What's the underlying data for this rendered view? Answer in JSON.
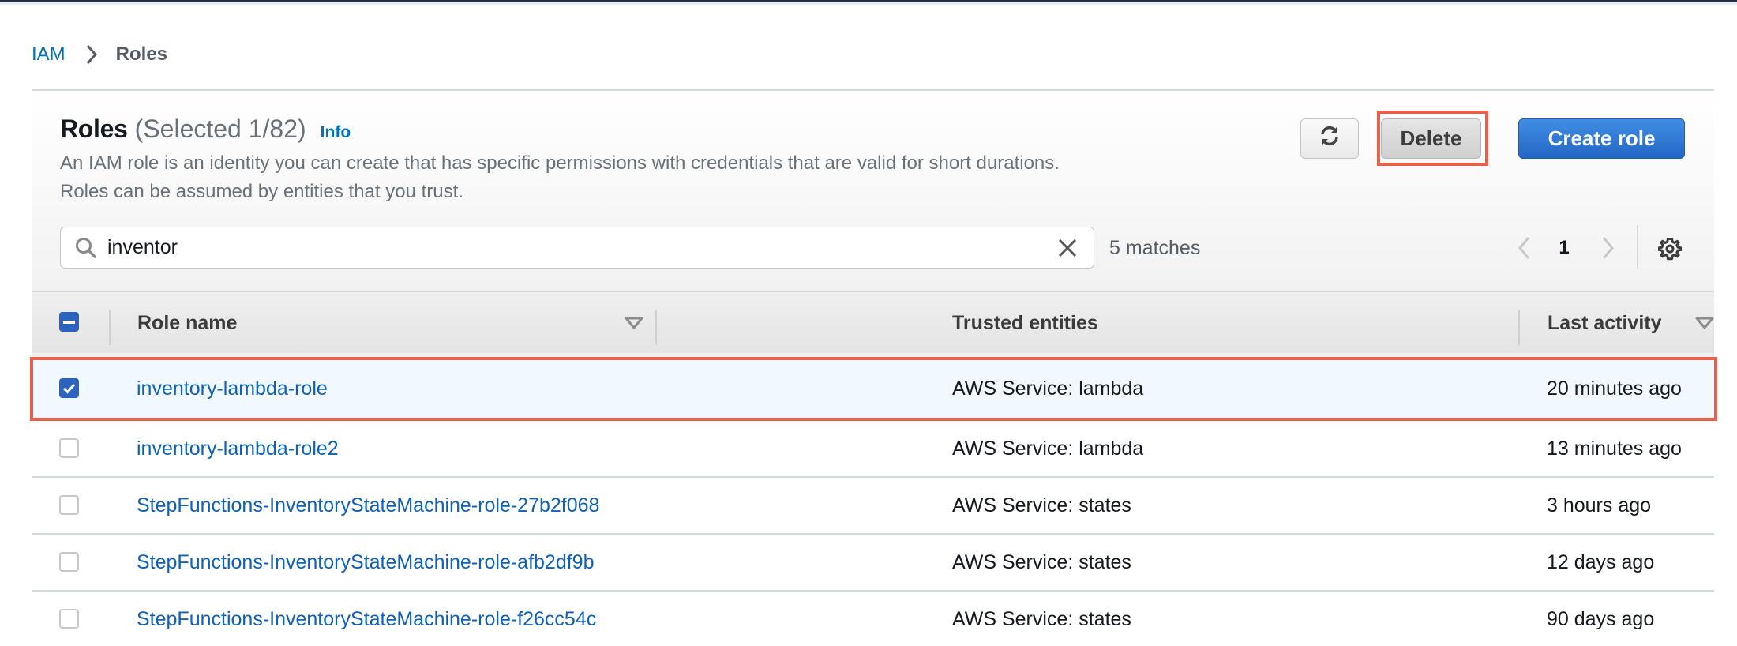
{
  "breadcrumb": {
    "items": [
      {
        "label": "IAM",
        "link": true
      },
      {
        "label": "Roles",
        "link": false
      }
    ]
  },
  "header": {
    "title": "Roles",
    "count": "(Selected 1/82)",
    "info_label": "Info",
    "description_line1": "An IAM role is an identity you can create that has specific permissions with credentials that are valid for short durations.",
    "description_line2": "Roles can be assumed by entities that you trust."
  },
  "toolbar": {
    "refresh_icon": "refresh-icon",
    "delete_label": "Delete",
    "create_label": "Create role"
  },
  "search": {
    "value": "inventor",
    "placeholder": "Search",
    "matches": "5 matches"
  },
  "pagination": {
    "current_page": "1"
  },
  "table": {
    "columns": [
      {
        "label": "Role name",
        "sortable": true
      },
      {
        "label": "Trusted entities",
        "sortable": false
      },
      {
        "label": "Last activity",
        "sortable": true
      }
    ],
    "select_all_state": "indeterminate",
    "rows": [
      {
        "name": "inventory-lambda-role",
        "trusted": "AWS Service: lambda",
        "last_activity": "20 minutes ago",
        "selected": true
      },
      {
        "name": "inventory-lambda-role2",
        "trusted": "AWS Service: lambda",
        "last_activity": "13 minutes ago",
        "selected": false
      },
      {
        "name": "StepFunctions-InventoryStateMachine-role-27b2f068",
        "trusted": "AWS Service: states",
        "last_activity": "3 hours ago",
        "selected": false
      },
      {
        "name": "StepFunctions-InventoryStateMachine-role-afb2df9b",
        "trusted": "AWS Service: states",
        "last_activity": "12 days ago",
        "selected": false
      },
      {
        "name": "StepFunctions-InventoryStateMachine-role-f26cc54c",
        "trusted": "AWS Service: states",
        "last_activity": "90 days ago",
        "selected": false
      }
    ]
  },
  "colors": {
    "link": "#0073bb",
    "primary": "#2266c4",
    "highlight": "#e8604c",
    "selected_row": "#f1f8ff"
  }
}
